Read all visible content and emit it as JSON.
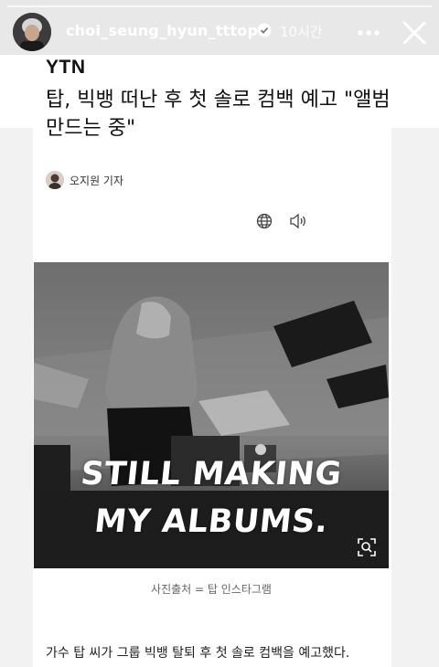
{
  "story": {
    "username": "choi_seung_hyun_tttop",
    "time": "10시간",
    "progress_fraction": 1.0
  },
  "article": {
    "brand": "YTN",
    "headline": "탑, 빅뱅 떠난 후 첫 솔로 컴백 예고 \"앨범 만드는 중\"",
    "reporter": "오지원 기자",
    "photo_overlay_line1": "STILL MAKING",
    "photo_overlay_line2": "MY ALBUMS.",
    "photo_caption": "사진출처 = 탑 인스타그램",
    "body_text": "가수 탑 씨가 그룹 빅뱅 탈퇴 후 첫 솔로 컴백을 예고했다."
  },
  "icons": {
    "verified": "verified-badge-icon",
    "more": "more-dots-icon",
    "close": "close-icon",
    "globe": "globe-icon",
    "speaker": "speaker-icon",
    "zoom": "zoom-icon"
  },
  "colors": {
    "photo_bg": "#5a5a5a",
    "text_primary": "#111111"
  }
}
